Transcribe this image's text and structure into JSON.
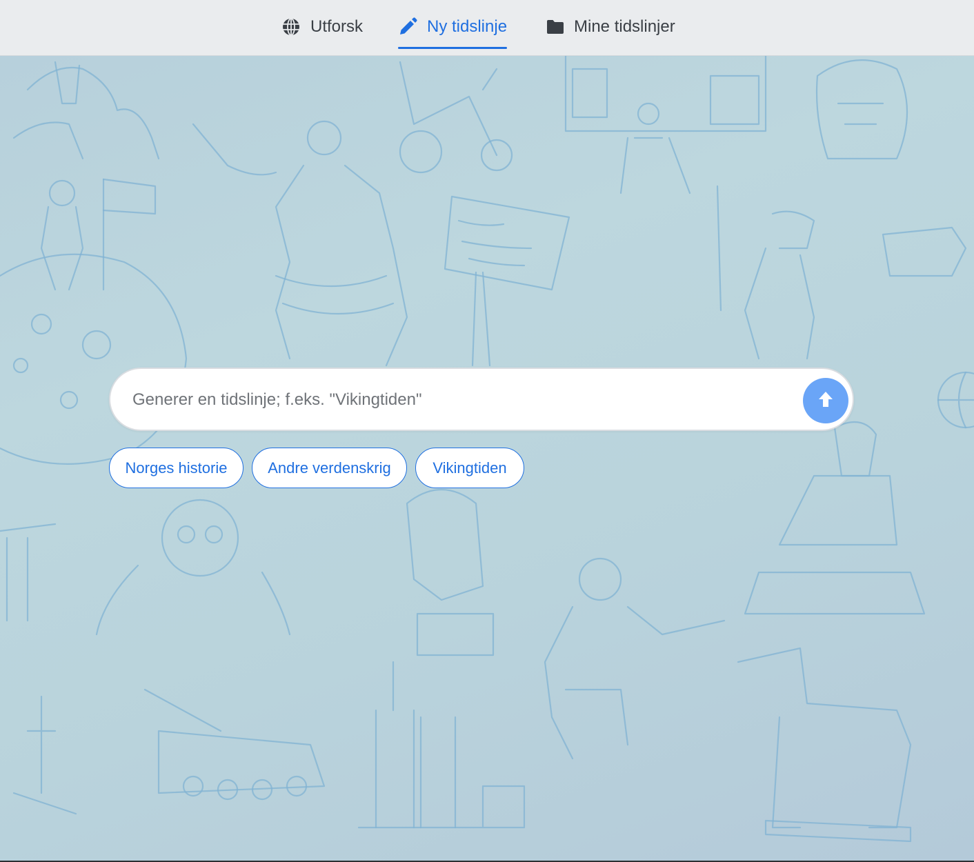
{
  "nav": {
    "tabs": [
      {
        "label": "Utforsk",
        "icon": "globe-icon",
        "active": false
      },
      {
        "label": "Ny tidslinje",
        "icon": "pencil-icon",
        "active": true
      },
      {
        "label": "Mine tidslinjer",
        "icon": "folder-icon",
        "active": false
      }
    ]
  },
  "search": {
    "placeholder": "Generer en tidslinje; f.eks. \"Vikingtiden\"",
    "value": "",
    "submit_icon": "arrow-up-icon"
  },
  "suggestions": [
    {
      "label": "Norges historie"
    },
    {
      "label": "Andre verdenskrig"
    },
    {
      "label": "Vikingtiden"
    }
  ],
  "colors": {
    "accent": "#1f6fe0",
    "submit_button": "#6aa5f7",
    "topbar": "#eaecee",
    "background": "#bdd7de",
    "sketch_lines": "#82b3d3"
  }
}
